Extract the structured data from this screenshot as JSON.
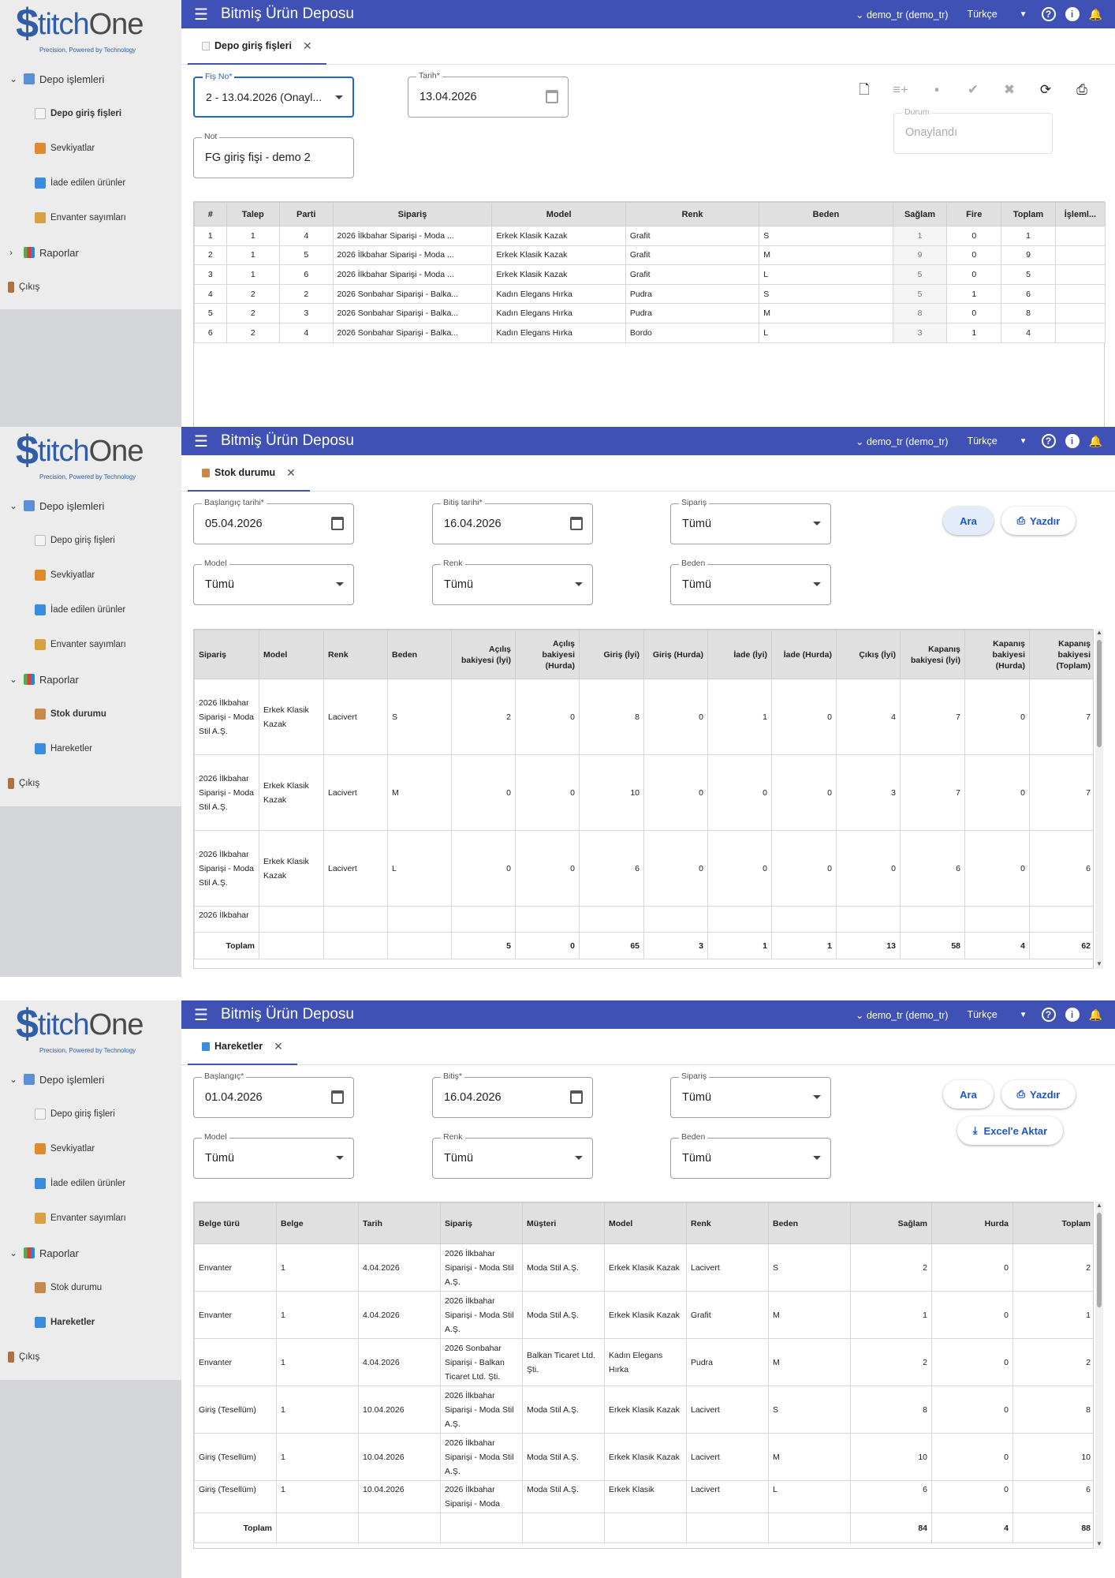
{
  "logo": {
    "s": "$",
    "name_main": "titch",
    "name_one": "One",
    "tagline": "Precision, Powered by Technology"
  },
  "topbar": {
    "title": "Bitmiş Ürün Deposu",
    "user": "demo_tr (demo_tr)",
    "language": "Türkçe"
  },
  "nav": {
    "depo": "Depo işlemleri",
    "giris": "Depo giriş fişleri",
    "sevk": "Sevkiyatlar",
    "iade": "İade edilen ürünler",
    "envanter": "Envanter sayımları",
    "raporlar": "Raporlar",
    "stok": "Stok durumu",
    "hareket": "Hareketler",
    "cikis": "Çıkış"
  },
  "panel1": {
    "tab": "Depo giriş fişleri",
    "fis_label": "Fiş No*",
    "fis_value": "2 - 13.04.2026 (Onayl...",
    "tarih_label": "Tarih*",
    "tarih_value": "13.04.2026",
    "not_label": "Not",
    "not_value": "FG giriş fişi - demo 2",
    "durum_label": "Durum",
    "durum_value": "Onaylandı",
    "headers": [
      "#",
      "Talep",
      "Parti",
      "Sipariş",
      "Model",
      "Renk",
      "Beden",
      "Sağlam",
      "Fire",
      "Toplam",
      "İşleml..."
    ],
    "rows": [
      [
        "1",
        "1",
        "4",
        "2026 İlkbahar Siparişi - Moda ...",
        "Erkek Klasik Kazak",
        "Grafit",
        "S",
        "1",
        "0",
        "1"
      ],
      [
        "2",
        "1",
        "5",
        "2026 İlkbahar Siparişi - Moda ...",
        "Erkek Klasik Kazak",
        "Grafit",
        "M",
        "9",
        "0",
        "9"
      ],
      [
        "3",
        "1",
        "6",
        "2026 İlkbahar Siparişi - Moda ...",
        "Erkek Klasik Kazak",
        "Grafit",
        "L",
        "5",
        "0",
        "5"
      ],
      [
        "4",
        "2",
        "2",
        "2026 Sonbahar Siparişi - Balka...",
        "Kadın Elegans Hırka",
        "Pudra",
        "S",
        "5",
        "1",
        "6"
      ],
      [
        "5",
        "2",
        "3",
        "2026 Sonbahar Siparişi - Balka...",
        "Kadın Elegans Hırka",
        "Pudra",
        "M",
        "8",
        "0",
        "8"
      ],
      [
        "6",
        "2",
        "4",
        "2026 Sonbahar Siparişi - Balka...",
        "Kadın Elegans Hırka",
        "Bordo",
        "L",
        "3",
        "1",
        "4"
      ]
    ]
  },
  "panel2": {
    "tab": "Stok durumu",
    "start_label": "Başlangıç tarihi*",
    "start_value": "05.04.2026",
    "end_label": "Bitiş tarihi*",
    "end_value": "16.04.2026",
    "siparis_label": "Sipariş",
    "siparis_value": "Tümü",
    "model_label": "Model",
    "model_value": "Tümü",
    "renk_label": "Renk",
    "renk_value": "Tümü",
    "beden_label": "Beden",
    "beden_value": "Tümü",
    "ara": "Ara",
    "yazdir": "Yazdır",
    "headers": [
      "Sipariş",
      "Model",
      "Renk",
      "Beden",
      "Açılış bakiyesi (İyi)",
      "Açılış bakiyesi (Hurda)",
      "Giriş (İyi)",
      "Giriş (Hurda)",
      "İade (İyi)",
      "İade (Hurda)",
      "Çıkış (İyi)",
      "Kapanış bakiyesi (İyi)",
      "Kapanış bakiyesi (Hurda)",
      "Kapanış bakiyesi (Toplam)"
    ],
    "rows": [
      [
        "2026 İlkbahar Siparişi - Moda Stil A.Ş.",
        "Erkek Klasik Kazak",
        "Lacivert",
        "S",
        "2",
        "0",
        "8",
        "0",
        "1",
        "0",
        "4",
        "7",
        "0",
        "7"
      ],
      [
        "2026 İlkbahar Siparişi - Moda Stil A.Ş.",
        "Erkek Klasik Kazak",
        "Lacivert",
        "M",
        "0",
        "0",
        "10",
        "0",
        "0",
        "0",
        "3",
        "7",
        "0",
        "7"
      ],
      [
        "2026 İlkbahar Siparişi - Moda Stil A.Ş.",
        "Erkek Klasik Kazak",
        "Lacivert",
        "L",
        "0",
        "0",
        "6",
        "0",
        "0",
        "0",
        "0",
        "6",
        "0",
        "6"
      ],
      [
        "2026 İlkbahar",
        "",
        "",
        "",
        "",
        "",
        "",
        "",
        "",
        "",
        "",
        "",
        "",
        ""
      ]
    ],
    "total_label": "Toplam",
    "totals": [
      "5",
      "0",
      "65",
      "3",
      "1",
      "1",
      "13",
      "58",
      "4",
      "62"
    ]
  },
  "panel3": {
    "tab": "Hareketler",
    "start_label": "Başlangıç*",
    "start_value": "01.04.2026",
    "end_label": "Bitiş*",
    "end_value": "16.04.2026",
    "siparis_label": "Sipariş",
    "siparis_value": "Tümü",
    "model_label": "Model",
    "model_value": "Tümü",
    "renk_label": "Renk",
    "renk_value": "Tümü",
    "beden_label": "Beden",
    "beden_value": "Tümü",
    "ara": "Ara",
    "yazdir": "Yazdır",
    "excel": "Excel'e Aktar",
    "headers": [
      "Belge türü",
      "Belge",
      "Tarih",
      "Sipariş",
      "Müşteri",
      "Model",
      "Renk",
      "Beden",
      "Sağlam",
      "Hurda",
      "Toplam"
    ],
    "rows": [
      [
        "Envanter",
        "1",
        "4.04.2026",
        "2026 İlkbahar Siparişi - Moda Stil A.Ş.",
        "Moda Stil A.Ş.",
        "Erkek Klasik Kazak",
        "Lacivert",
        "S",
        "2",
        "0",
        "2"
      ],
      [
        "Envanter",
        "1",
        "4.04.2026",
        "2026 İlkbahar Siparişi - Moda Stil A.Ş.",
        "Moda Stil A.Ş.",
        "Erkek Klasik Kazak",
        "Grafit",
        "M",
        "1",
        "0",
        "1"
      ],
      [
        "Envanter",
        "1",
        "4.04.2026",
        "2026 Sonbahar Siparişi - Balkan Ticaret Ltd. Şti.",
        "Balkan Ticaret Ltd. Şti.",
        "Kadın Elegans Hırka",
        "Pudra",
        "M",
        "2",
        "0",
        "2"
      ],
      [
        "Giriş (Tesellüm)",
        "1",
        "10.04.2026",
        "2026 İlkbahar Siparişi - Moda Stil A.Ş.",
        "Moda Stil A.Ş.",
        "Erkek Klasik Kazak",
        "Lacivert",
        "S",
        "8",
        "0",
        "8"
      ],
      [
        "Giriş (Tesellüm)",
        "1",
        "10.04.2026",
        "2026 İlkbahar Siparişi - Moda Stil A.Ş.",
        "Moda Stil A.Ş.",
        "Erkek Klasik Kazak",
        "Lacivert",
        "M",
        "10",
        "0",
        "10"
      ],
      [
        "Giriş (Tesellüm)",
        "1",
        "10.04.2026",
        "2026 İlkbahar Siparişi - Moda",
        "Moda Stil A.Ş.",
        "Erkek Klasik",
        "Lacivert",
        "L",
        "6",
        "0",
        "6"
      ]
    ],
    "total_label": "Toplam",
    "totals": [
      "84",
      "4",
      "88"
    ]
  }
}
